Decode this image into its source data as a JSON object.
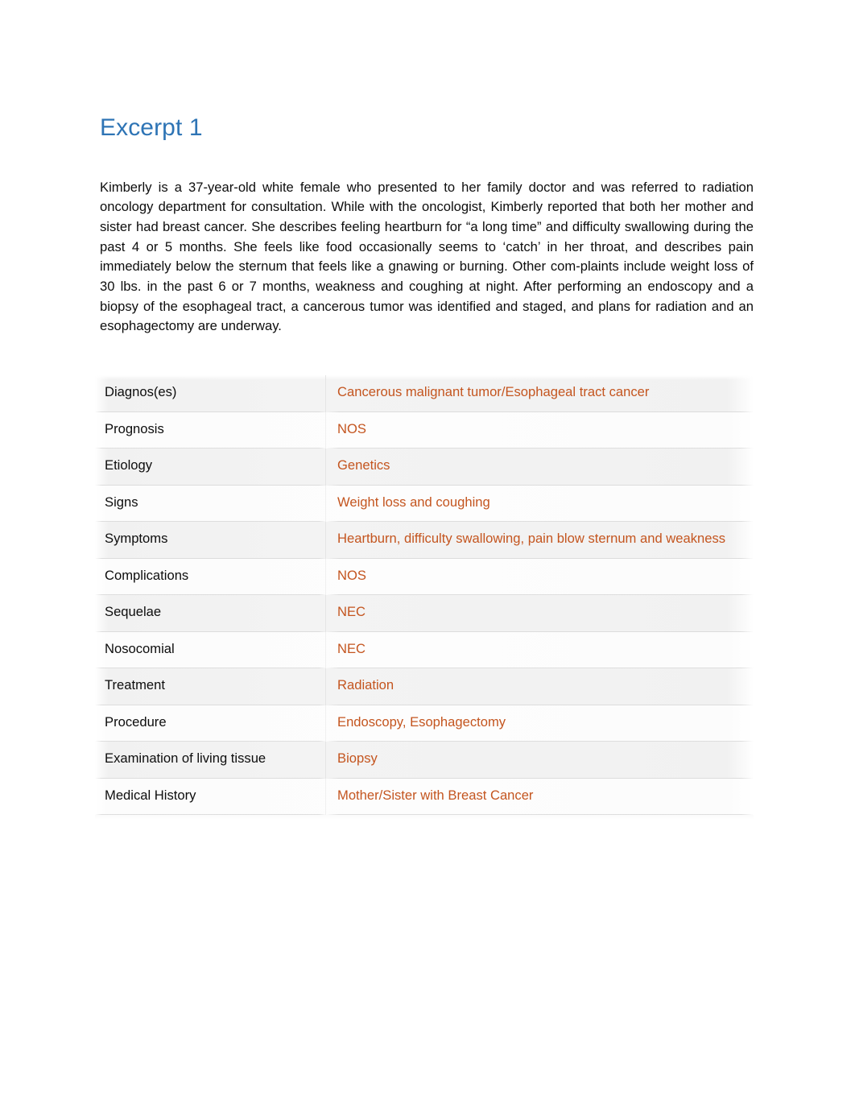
{
  "document": {
    "heading": "Excerpt 1",
    "body_paragraph": "Kimberly is a 37-year-old white female who presented to her family doctor and was referred to radiation oncology department for consultation. While with the oncologist, Kimberly reported that both her mother and sister had breast cancer. She describes feeling heartburn for “a long time” and difficulty swallowing during the past 4 or 5 months. She feels like food occasionally seems to ‘catch’ in her throat, and describes pain immediately below the sternum that feels like a gnawing or burning. Other com-plaints include weight loss of 30 lbs. in the past 6 or 7 months, weakness and coughing at night.  After performing an endoscopy and a biopsy of the esophageal tract, a cancerous tumor was identified and staged, and plans for radiation and an esophagectomy are underway."
  },
  "colors": {
    "heading_blue": "#2E74B5",
    "value_orange": "#C4551F",
    "body_text": "#0D0D0D",
    "row_shaded": "#F2F2F2",
    "row_plain": "#FDFDFD"
  },
  "table": {
    "rows": [
      {
        "label": "Diagnos(es)",
        "value": "Cancerous malignant tumor/Esophageal tract cancer"
      },
      {
        "label": "Prognosis",
        "value": "NOS"
      },
      {
        "label": "Etiology",
        "value": "Genetics"
      },
      {
        "label": "Signs",
        "value": "Weight loss and coughing"
      },
      {
        "label": "Symptoms",
        "value": "Heartburn, difficulty swallowing, pain blow sternum and weakness"
      },
      {
        "label": "Complications",
        "value": "NOS"
      },
      {
        "label": "Sequelae",
        "value": "NEC"
      },
      {
        "label": "Nosocomial",
        "value": "NEC"
      },
      {
        "label": "Treatment",
        "value": "Radiation"
      },
      {
        "label": "Procedure",
        "value": "Endoscopy, Esophagectomy"
      },
      {
        "label": "Examination of living tissue",
        "value": "Biopsy"
      },
      {
        "label": "Medical History",
        "value": "Mother/Sister with Breast Cancer"
      }
    ]
  }
}
